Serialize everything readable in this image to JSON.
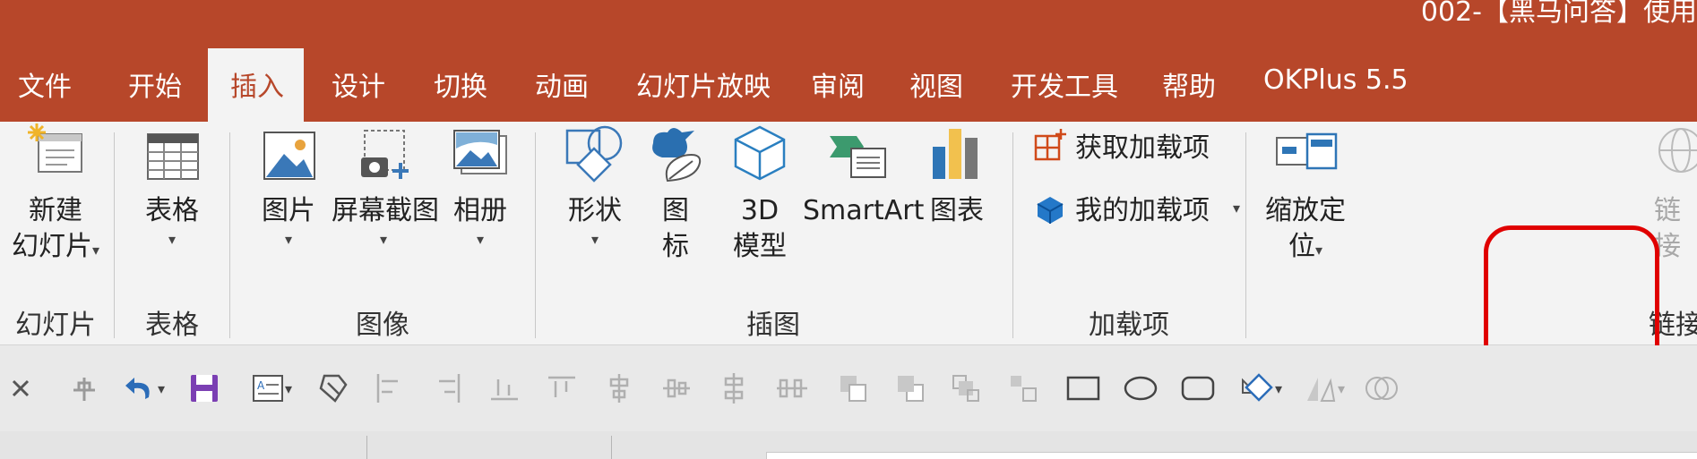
{
  "window": {
    "title": "002-【黑马问答】使用"
  },
  "tabs": [
    {
      "label": "文件"
    },
    {
      "label": "开始"
    },
    {
      "label": "插入",
      "active": true
    },
    {
      "label": "设计"
    },
    {
      "label": "切换"
    },
    {
      "label": "动画"
    },
    {
      "label": "幻灯片放映"
    },
    {
      "label": "审阅"
    },
    {
      "label": "视图"
    },
    {
      "label": "开发工具"
    },
    {
      "label": "帮助"
    },
    {
      "label": "OKPlus 5.5"
    }
  ],
  "ribbon": {
    "groups": {
      "slides": "幻灯片",
      "table": "表格",
      "images": "图像",
      "illustrations": "插图",
      "addins": "加载项",
      "links": "链接"
    },
    "buttons": {
      "new_slide_1": "新建",
      "new_slide_2": "幻灯片",
      "table": "表格",
      "picture": "图片",
      "screenshot": "屏幕截图",
      "album": "相册",
      "shapes": "形状",
      "icons_1": "图",
      "icons_2": "标",
      "model_1": "3D",
      "model_2": "模型",
      "smartart": "SmartArt",
      "chart": "图表",
      "get_addins": "获取加载项",
      "my_addins": "我的加载项",
      "zoom_1": "缩放定",
      "zoom_2": "位",
      "link_1": "链",
      "link_2": "接"
    },
    "caret": "▾"
  },
  "colors": {
    "accent": "#b7472a",
    "ribbon_bg": "#f3f3f3",
    "highlight": "#e00000"
  },
  "icons": [
    "new-slide-icon",
    "table-icon",
    "picture-icon",
    "screenshot-icon",
    "album-icon",
    "shapes-icon",
    "icons-icon",
    "3d-model-icon",
    "smartart-icon",
    "chart-icon",
    "store-icon",
    "my-addins-icon",
    "zoom-icon",
    "link-icon"
  ]
}
